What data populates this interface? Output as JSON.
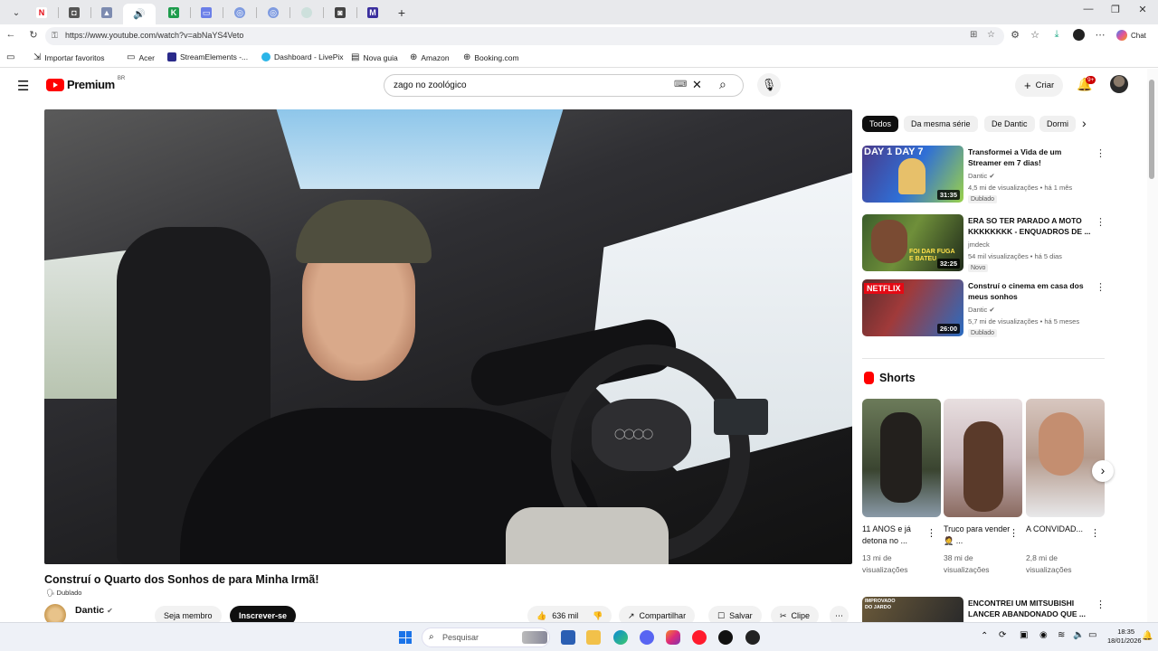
{
  "browser": {
    "url": "https://www.youtube.com/watch?v=abNaYS4Veto",
    "chat_label": "Chat",
    "bookmarks": [
      "Importar favoritos",
      "Acer",
      "StreamElements -...",
      "Dashboard - LivePix",
      "Nova guia",
      "Amazon",
      "Booking.com"
    ]
  },
  "youtube": {
    "logo_text": "Premium",
    "country_code": "BR",
    "search_value": "zago no zoológico",
    "create_label": "Criar",
    "notif_count": "9+"
  },
  "video": {
    "title": "Construí o Quarto dos Sonhos de para Minha Irmã!",
    "dubbed": "Dublado",
    "channel": "Dantic",
    "join_label": "Seja membro",
    "subscribe_label": "Inscrever-se",
    "likes": "636 mil",
    "share_label": "Compartilhar",
    "save_label": "Salvar",
    "clip_label": "Clipe"
  },
  "chips": [
    "Todos",
    "Da mesma série",
    "De Dantic",
    "Dormi"
  ],
  "recommendations": [
    {
      "title": "Transformei a Vida de um Streamer em 7 dias!",
      "channel": "Dantic",
      "stats": "4,5 mi de visualizações • há 1 mês",
      "badge": "Dublado",
      "duration": "31:35",
      "thumb_text": "DAY 1 DAY 7"
    },
    {
      "title": "ERA SO TER PARADO A MOTO KKKKKKKK - ENQUADROS DE ...",
      "channel": "jmdeck",
      "stats": "54 mil visualizações • há 5 dias",
      "badge": "Novo",
      "duration": "32:25",
      "thumb_text": "FOI DAR FUGA E BATEU"
    },
    {
      "title": "Construí o cinema em casa dos meus sonhos",
      "channel": "Dantic",
      "stats": "5,7 mi de visualizações • há 5 meses",
      "badge": "Dublado",
      "duration": "26:00",
      "thumb_text": "NETFLIX"
    }
  ],
  "shorts_heading": "Shorts",
  "shorts": [
    {
      "title": "11 ANOS e já detona no ...",
      "views": "13 mi de visualizações"
    },
    {
      "title": "Truco para vender 🤵 ...",
      "views": "38 mi de visualizações"
    },
    {
      "title": "A CONVIDAD...",
      "views": "2,8 mi de visualizações"
    }
  ],
  "next_rec": {
    "title": "ENCONTREI UM MITSUBISHI LANCER ABANDONADO QUE ...",
    "thumb_text": "IMPROVADO DO JARDO"
  },
  "taskbar": {
    "search_placeholder": "Pesquisar",
    "time": "18:35",
    "date": "18/01/2026"
  },
  "colors": {
    "youtube_red": "#ff0000",
    "brand_dark": "#0f0f0f"
  }
}
